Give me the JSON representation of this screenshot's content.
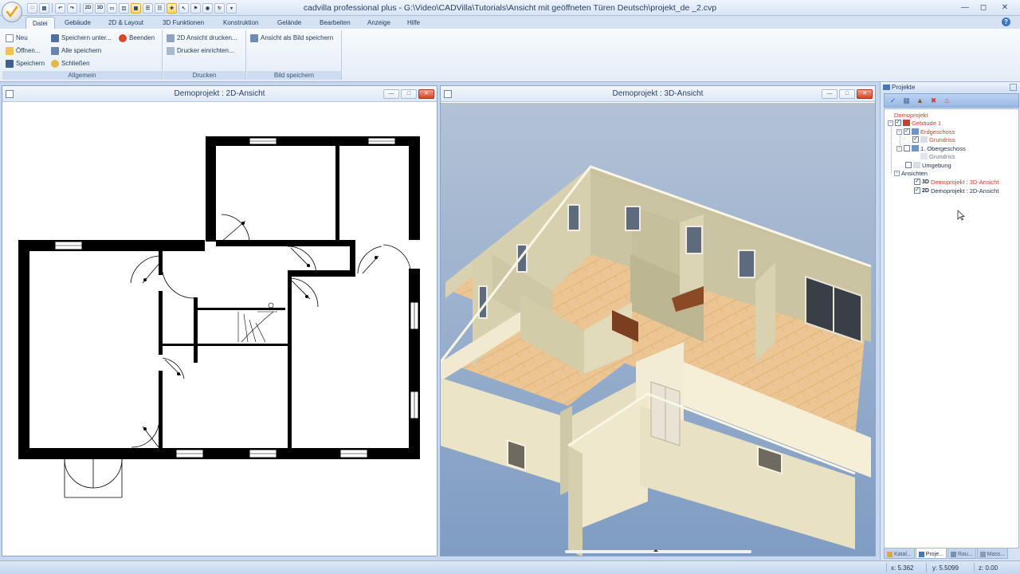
{
  "window": {
    "title": "cadvilla professional plus - G:\\Video\\CADVilla\\Tutorials\\Ansicht mit geöffneten Türen Deutsch\\projekt_de _2.cvp"
  },
  "qat": {
    "btn_2d": "2D",
    "btn_3d": "3D"
  },
  "tabs": [
    "Datei",
    "Gebäude",
    "2D & Layout",
    "3D Funktionen",
    "Konstruktion",
    "Gelände",
    "Bearbeiten",
    "Anzeige",
    "Hilfe"
  ],
  "help_glyph": "?",
  "ribbon": {
    "allgemein": {
      "label": "Allgemein",
      "neu": "Neu",
      "oeffnen": "Öffnen...",
      "speichern": "Speichern",
      "speichern_unter": "Speichern unter...",
      "alle_speichern": "Alle speichern",
      "schliessen": "Schließen",
      "beenden": "Beenden"
    },
    "drucken": {
      "label": "Drucken",
      "ansicht_drucken": "2D Ansicht drucken...",
      "drucker": "Drucker einrichten..."
    },
    "bild": {
      "label": "Bild speichern",
      "als_bild": "Ansicht als Bild speichern"
    }
  },
  "view2d": {
    "title": "Demoprojekt : 2D-Ansicht"
  },
  "view3d": {
    "title": "Demoprojekt : 3D-Ansicht"
  },
  "projects": {
    "header": "Projekte",
    "tree": {
      "root": "Demoprojekt",
      "gebaeude": "Gebäude 1",
      "erdgeschoss": "Erdgeschoss",
      "grundriss1": "Grundriss",
      "obergeschoss": "1. Obergeschoss",
      "grundriss2": "Grundriss",
      "umgebung": "Umgebung",
      "ansichten": "Ansichten",
      "view3d_badge": "3D",
      "view3d_label": "Demoprojekt : 3D-Ansicht",
      "view2d_badge": "2D",
      "view2d_label": "Demoprojekt : 2D-Ansicht"
    },
    "tabs": [
      "Katal...",
      "Proje...",
      "Rau...",
      "Mass..."
    ]
  },
  "status": {
    "x": "x: 5.362",
    "y": "y: 5.5099",
    "z": "z: 0.00"
  },
  "colors": {
    "accent": "#3a76c6",
    "selected": "#c8412c",
    "wall2d": "#000000",
    "floor3d": "#e8c08c",
    "sky3d": "#8ea8c9"
  }
}
